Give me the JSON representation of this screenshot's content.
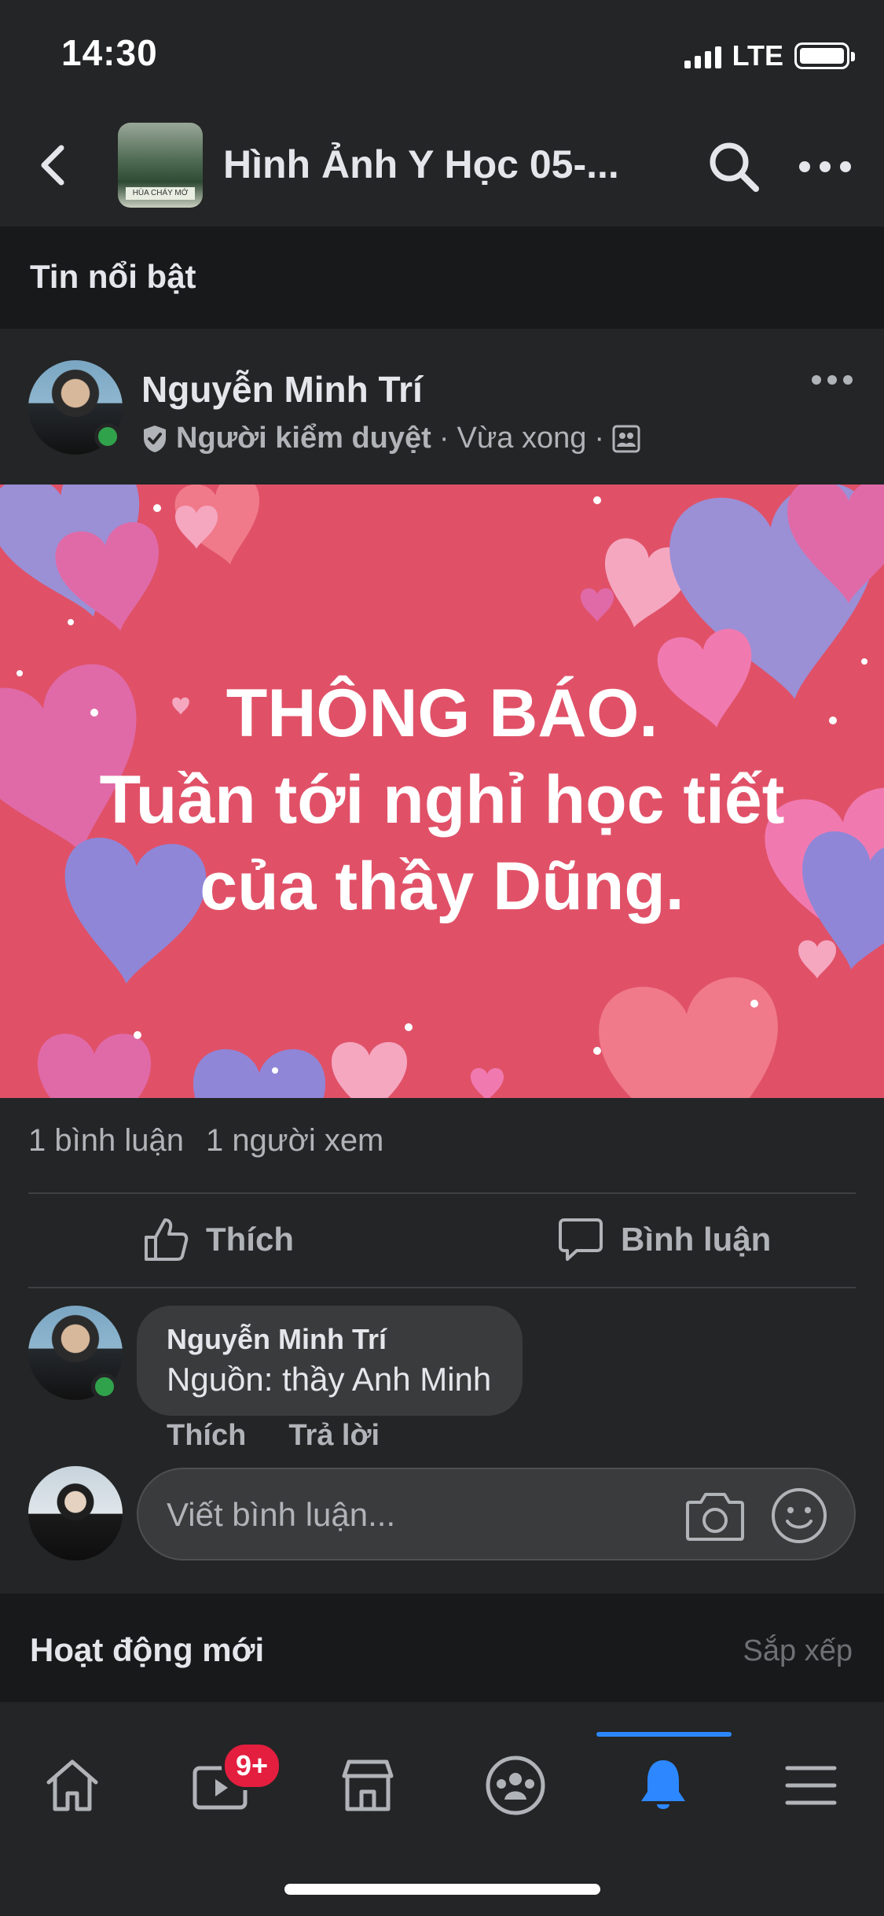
{
  "status_bar": {
    "time": "14:30",
    "network": "LTE"
  },
  "header": {
    "group_name": "Hình Ảnh Y Học 05-...",
    "thumb_caption": "HÙA CHÁY MỚ"
  },
  "featured_section": {
    "title": "Tin nổi bật"
  },
  "post": {
    "author": "Nguyễn Minh Trí",
    "role": "Người kiểm duyệt",
    "separator": "·",
    "time": "Vừa xong",
    "text_lines": [
      "THÔNG BÁO.",
      "Tuần tới nghỉ học tiết",
      "của thầy Dũng."
    ],
    "background_color": "#e05168",
    "stats": {
      "comments": "1 bình luận",
      "views": "1 người xem"
    },
    "actions": {
      "like": "Thích",
      "comment": "Bình luận"
    }
  },
  "comment": {
    "author": "Nguyễn Minh Trí",
    "text": "Nguồn: thầy Anh Minh",
    "like": "Thích",
    "reply": "Trả lời"
  },
  "composer": {
    "placeholder": "Viết bình luận..."
  },
  "activity_section": {
    "title": "Hoạt động mới",
    "sort": "Sắp xếp"
  },
  "tab_bar": {
    "tabs": [
      "home-icon",
      "watch-icon",
      "marketplace-icon",
      "groups-icon",
      "notifications-icon",
      "menu-icon"
    ],
    "active_index": 4,
    "watch_badge": "9+",
    "accent_color": "#2d88ff"
  }
}
